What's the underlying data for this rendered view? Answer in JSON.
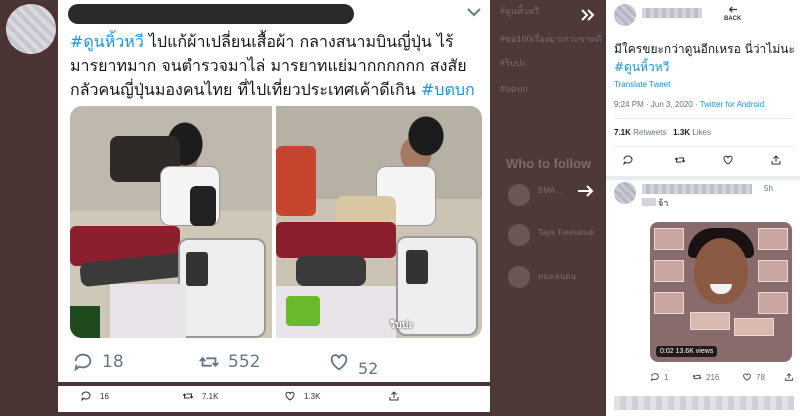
{
  "main_tweet": {
    "text_parts": [
      {
        "t": "#ดูนหิ้วหวี",
        "hashtag": true
      },
      {
        "t": " ไปแก้ผ้าเปลี่ยนเสื้อผ้า กลางสนามบินญี่ปุ่น ไร้มารยาทมาก จนตำรวจมาไล่ มารยาทแย่มากกกกกก สงสัยกลัวคนญี่ปุ่นมองคนไทย ที่ไปเที่ยวประเทศเค้าดีเกิน ",
        "hashtag": false
      },
      {
        "t": "#บตบก",
        "hashtag": true
      }
    ],
    "image_caption": "ริบปะ",
    "replies": "18",
    "retweets": "552",
    "likes": "52"
  },
  "bottom_strip": {
    "replies": "16",
    "retweets": "7.1K",
    "likes": "1.3K"
  },
  "right_tweet": {
    "back_label": "BACK",
    "text_plain": "มีใครขยะกว่าดูนอีกเหรอ นี่ว่าไม่นะ ",
    "text_hashtag": "#ดูนหิ้วหวี",
    "translate": "Translate Tweet",
    "time": "9:24 PM · Jun 3, 2020 · ",
    "app": "Twitter for Android",
    "retweets_count": "7.1K",
    "retweets_label": "Retweets",
    "likes_count": "1.3K",
    "likes_label": "Likes"
  },
  "right_tweet_2": {
    "time": "5h",
    "text": "จ้า",
    "media_badge": "0:02  13.6K views",
    "replies": "1",
    "retweets": "216",
    "likes": "78"
  },
  "background": {
    "trends": [
      "#ดูนหิ้วหวี",
      "#ขอ100เรื่องมาเกาะขาดดี",
      "#ริบปะ",
      "#บตบก"
    ],
    "who_to_follow": "Who to follow",
    "suggestions": [
      "BMA...",
      "Taya Treesanuk",
      "ทองเล่นคน"
    ]
  },
  "colors": {
    "hashtag": "#1b95e0",
    "text": "#14171a",
    "muted": "#657786",
    "backdrop": "#4b3434"
  }
}
